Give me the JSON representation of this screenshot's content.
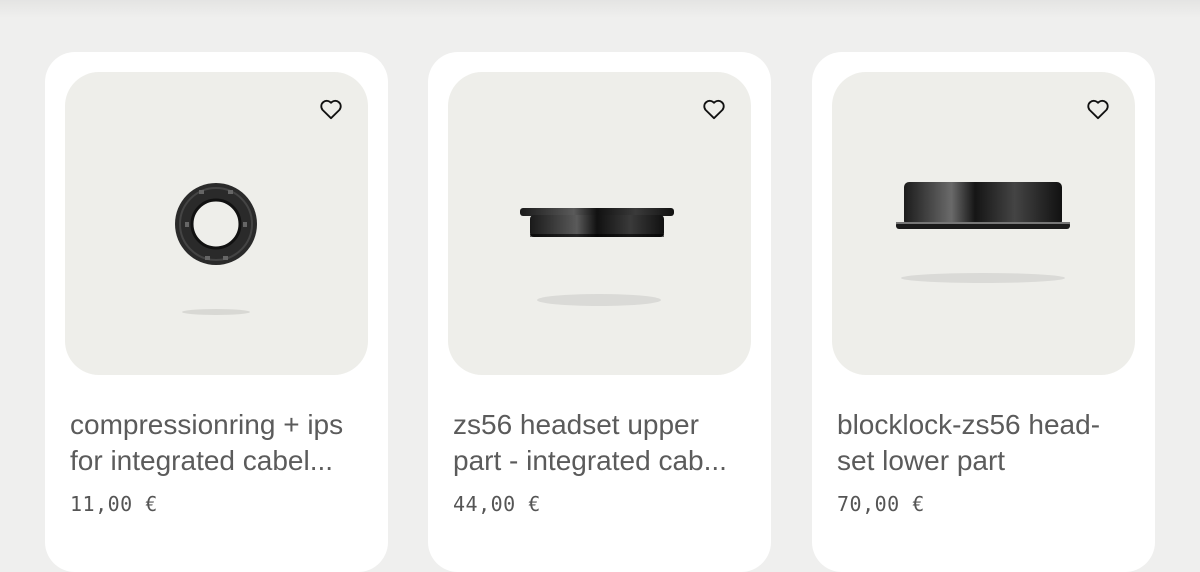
{
  "products": [
    {
      "title": "compressionring + ips for integrated cabel...",
      "price": "11,00 €",
      "icon": "heart-outline-icon"
    },
    {
      "title": "zs56 headset upper part - integrated cab...",
      "price": "44,00 €",
      "icon": "heart-outline-icon"
    },
    {
      "title": "blocklock-zs56 head-set lower part",
      "price": "70,00 €",
      "icon": "heart-outline-icon"
    }
  ],
  "colors": {
    "page_bg": "#efefee",
    "card_bg": "#ffffff",
    "media_bg": "#eeeeea",
    "text": "#5b5b5b"
  }
}
